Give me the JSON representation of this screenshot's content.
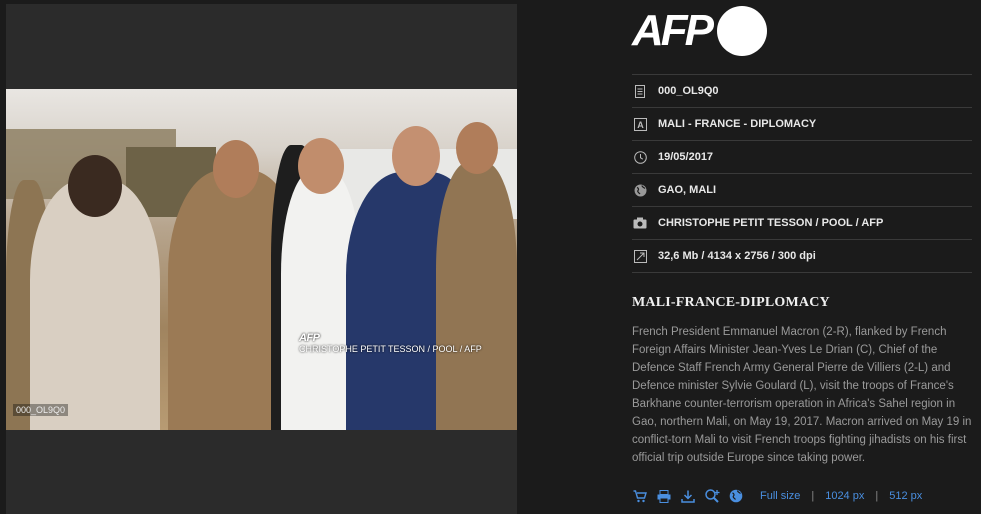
{
  "photo": {
    "id_badge": "000_OL9Q0",
    "watermark_logo": "AFP",
    "watermark_credit": "CHRISTOPHE PETIT TESSON / POOL / AFP"
  },
  "brand": {
    "logo_text": "AFP"
  },
  "meta": [
    {
      "icon": "document-icon",
      "value": "000_OL9Q0"
    },
    {
      "icon": "text-icon",
      "value": "MALI - FRANCE - DIPLOMACY"
    },
    {
      "icon": "clock-icon",
      "value": "19/05/2017"
    },
    {
      "icon": "globe-icon",
      "value": "GAO, MALI"
    },
    {
      "icon": "camera-icon",
      "value": "CHRISTOPHE PETIT TESSON / POOL / AFP"
    },
    {
      "icon": "resize-icon",
      "value": "32,6 Mb / 4134 x 2756 / 300 dpi"
    }
  ],
  "title": "MALI-FRANCE-DIPLOMACY",
  "caption": "French President Emmanuel Macron (2-R), flanked by French Foreign Affairs Minister Jean-Yves Le Drian (C), Chief of the Defence Staff French Army General Pierre de Villiers (2-L) and Defence minister Sylvie Goulard (L), visit the troops of France's Barkhane counter-terrorism operation in Africa's Sahel region in Gao, northern Mali, on May 19, 2017. Macron arrived on May 19 in conflict-torn Mali to visit French troops fighting jihadists on his first official trip outside Europe since taking power.",
  "actions": {
    "sizes": [
      "Full size",
      "1024 px",
      "512 px"
    ]
  },
  "colors": {
    "accent": "#4a8fe0",
    "background": "#1b1b1b"
  }
}
